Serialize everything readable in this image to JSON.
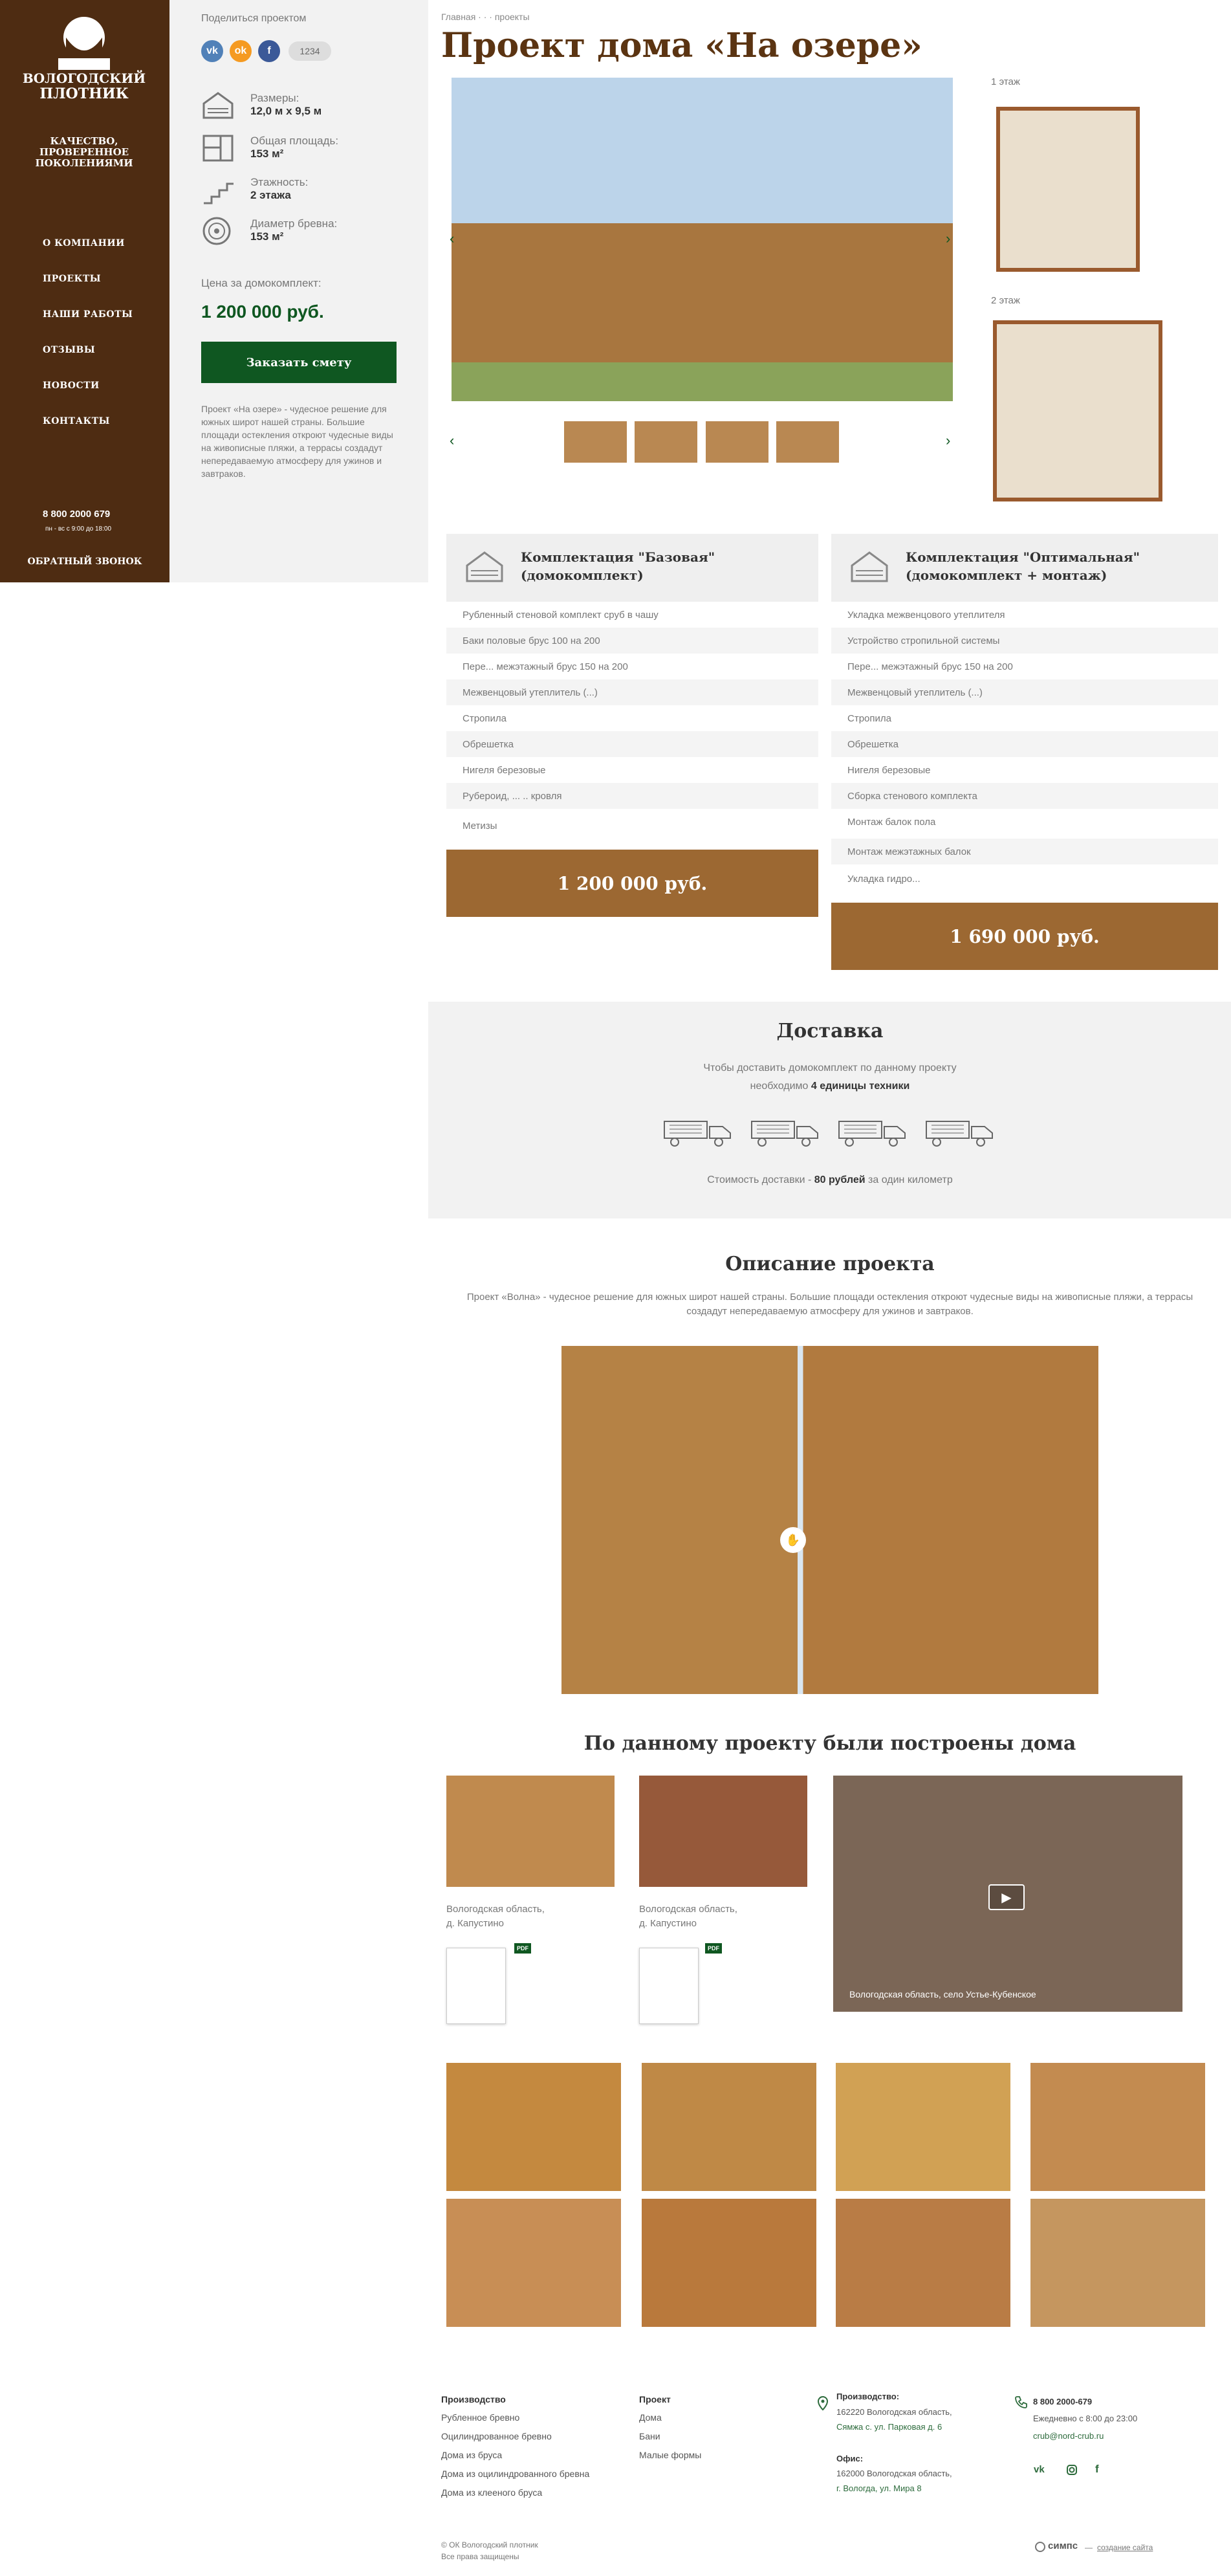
{
  "sidebar": {
    "logo_text": "ВОЛОГОДСКИЙ ПЛОТНИК",
    "tagline": [
      "КАЧЕСТВО,",
      "ПРОВЕРЕННОЕ",
      "ПОКОЛЕНИЯМИ"
    ],
    "nav": [
      "О КОМПАНИИ",
      "ПРОЕКТЫ",
      "НАШИ РАБОТЫ",
      "ОТЗЫВЫ",
      "НОВОСТИ",
      "КОНТАКТЫ"
    ],
    "phone": "8 800 2000 679",
    "hours": "пн - вс с 9:00 до 18:00",
    "callback": "ОБРАТНЫЙ ЗВОНОК"
  },
  "share": {
    "label": "Поделиться проектом",
    "count": "1234",
    "vk": "vk",
    "ok": "ok",
    "fb": "f"
  },
  "specs": [
    {
      "icon": "house-dimensions-icon",
      "label": "Размеры:",
      "value": "12,0 м х 9,5 м"
    },
    {
      "icon": "floor-area-icon",
      "label": "Общая площадь:",
      "value": "153 м²"
    },
    {
      "icon": "floors-icon",
      "label": "Этажность:",
      "value": "2 этажа"
    },
    {
      "icon": "log-diameter-icon",
      "label": "Диаметр бревна:",
      "value": "153 м²"
    }
  ],
  "price_block": {
    "label": "Цена за домокомплект:",
    "value": "1 200 000 руб."
  },
  "order_button": "Заказать смету",
  "description": "Проект «На озере» - чудесное решение для южных широт нашей страны. Большие площади остекления откроют чудесные виды на живописные пляжи, а террасы создадут непередаваемую атмосферу для ужинов и завтраков.",
  "breadcrumbs": "Главная · · · проекты",
  "title": "Проект дома «На озере»",
  "plans": {
    "floor1": "1 этаж",
    "floor2": "2 этаж"
  },
  "kits": [
    {
      "title": "Комплектация \"Базовая\"",
      "subtitle": "(домокомплект)",
      "items": [
        "Рубленный стеновой комплект сруб в чашу",
        "Баки половые брус 100 на 200",
        "Пере... межэтажный брус 150 на 200",
        "Межвенцовый утеплитель (...)",
        "Стропила",
        "Обрешетка",
        "Нигеля березовые",
        "Рубероид, ... .. кровля",
        "Метизы"
      ],
      "price": "1 200 000 руб."
    },
    {
      "title": "Комплектация \"Оптимальная\"",
      "subtitle": "(домокомплект + монтаж)",
      "items": [
        "Укладка межвенцового утеплителя",
        "Устройство стропильной системы",
        "Пере... межэтажный брус 150 на 200",
        "Межвенцовый утеплитель (...)",
        "Стропила",
        "Обрешетка",
        "Нигеля березовые",
        "Сборка стенового комплекта",
        "Монтаж балок пола",
        "Монтаж межэтажных балок",
        "Укладка гидро..."
      ],
      "price": "1 690 000 руб."
    }
  ],
  "delivery": {
    "title": "Доставка",
    "line1": "Чтобы доставить домокомплект по данному проекту",
    "line2_pre": "необходимо ",
    "line2_bold": "4 единицы техники",
    "cost_pre": "Стоимость доставки - ",
    "cost_bold": "80 рублей",
    "cost_post": " за один километр"
  },
  "project_desc": {
    "title": "Описание проекта",
    "text1": "Проект «Волна» - чудесное решение для южных широт нашей страны. Большие площади остекления откроют чудесные виды на живописные пляжи, а террасы",
    "text2": "создадут непередаваемую атмосферу для ужинов и завтраков."
  },
  "built": {
    "title": "По данному проекту были построены дома",
    "items": [
      {
        "location1": "Вологодская область,",
        "location2": "д. Капустино",
        "badge": "PDF"
      },
      {
        "location1": "Вологодская область,",
        "location2": "д. Капустино",
        "badge": "PDF"
      }
    ],
    "video_caption": "Вологодская область, село Устье-Кубенское"
  },
  "footer": {
    "col1": {
      "title": "Производство",
      "links": [
        "Рубленное бревно",
        "Оцилиндрованное бревно",
        "Дома из бруса",
        "Дома из оцилиндрованного бревна",
        "Дома из клееного бруса"
      ]
    },
    "col2": {
      "title": "Проект",
      "links": [
        "Дома",
        "Бани",
        "Малые формы"
      ]
    },
    "prod": {
      "title": "Производство:",
      "line1": "162220 Вологодская область,",
      "line2": "Сямжа с. ул. Парковая д. 6"
    },
    "office": {
      "title": "Офис:",
      "line1": "162000 Вологодская область,",
      "line2": "г. Вологда, ул. Мира 8"
    },
    "phone": "8 800 2000-679",
    "hours": "Ежедневно с 8:00 до 23:00",
    "email": "crub@nord-crub.ru",
    "copyright1": "© ОК Вологодский плотник",
    "copyright2": "Все права защищены",
    "brand": "симпс",
    "created": "создание сайта"
  },
  "colors": {
    "brown": "#4e2c12",
    "green": "#0f5721",
    "title": "#5b3412"
  }
}
